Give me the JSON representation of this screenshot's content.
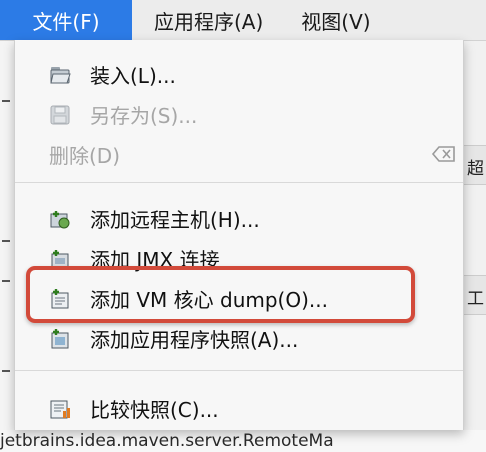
{
  "menubar": {
    "file": "文件(F)",
    "application": "应用程序(A)",
    "view": "视图(V)"
  },
  "menu": {
    "items": [
      {
        "label": "装入(L)...",
        "icon": "folder-open-icon",
        "enabled": true
      },
      {
        "label": "另存为(S)...",
        "icon": "save-disk-icon",
        "enabled": false
      },
      {
        "label": "删除(D)",
        "icon": "",
        "enabled": false,
        "accessory": "delete-key-icon"
      },
      {
        "label": "添加远程主机(H)...",
        "icon": "add-remote-host-icon",
        "enabled": true
      },
      {
        "label": "添加 JMX 连接",
        "icon": "add-jmx-connection-icon",
        "enabled": true
      },
      {
        "label": "添加 VM 核心 dump(O)...",
        "icon": "add-core-dump-icon",
        "enabled": true
      },
      {
        "label": "添加应用程序快照(A)...",
        "icon": "add-snapshot-icon",
        "enabled": true
      },
      {
        "label": "比较快照(C)...",
        "icon": "compare-snapshots-icon",
        "enabled": true
      }
    ]
  },
  "background": {
    "bottom_text": "jetbrains.idea.maven.server.RemoteMa",
    "right_glyph_1": "超",
    "right_glyph_2": "工"
  },
  "colors": {
    "menubar_active": "#2c7be6",
    "highlight_border": "#d24a3a",
    "disabled_text": "#a6a6a6"
  }
}
